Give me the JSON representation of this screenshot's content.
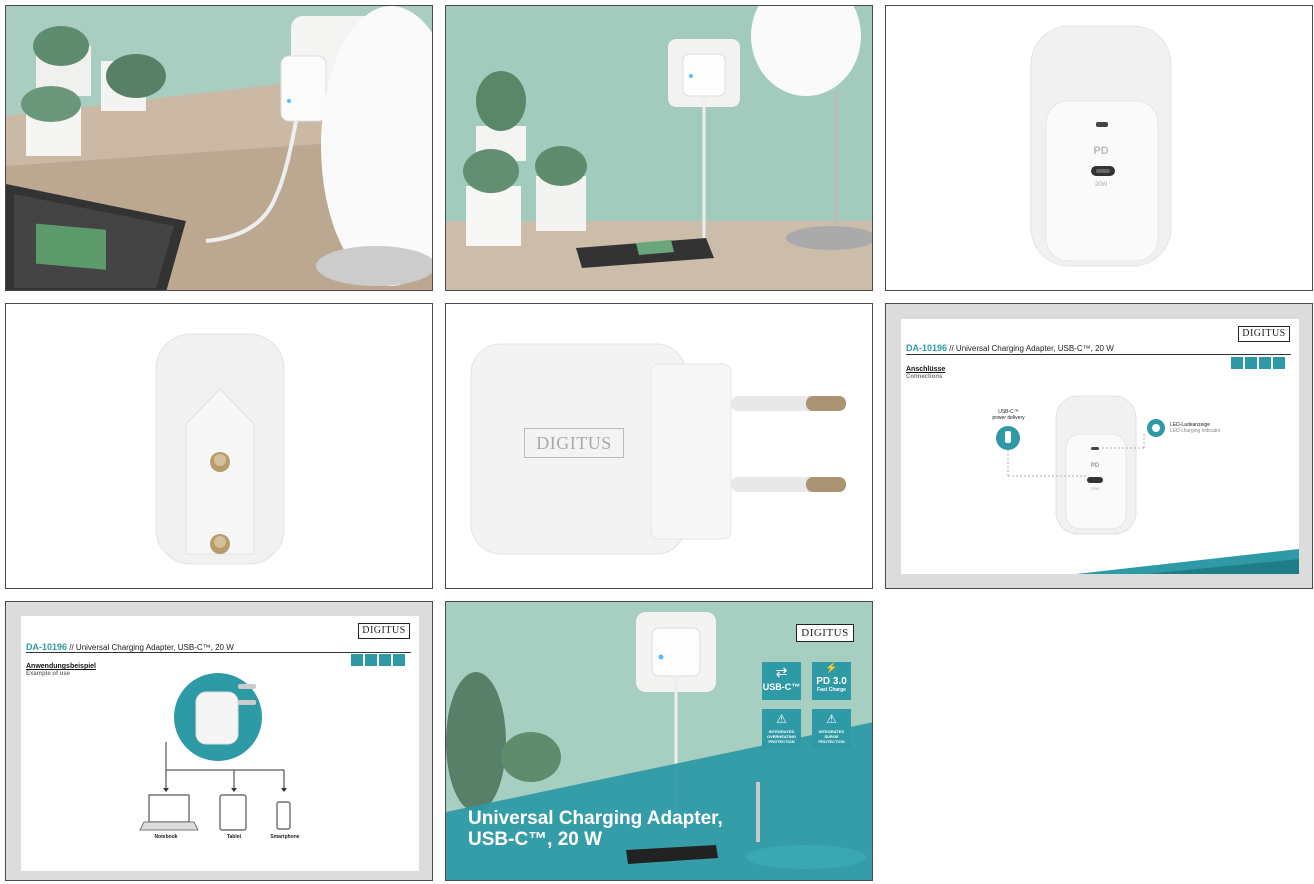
{
  "slide_panel_connections": {
    "sku": "DA-10196",
    "product": " //  Universal Charging Adapter, USB-C™, 20 W",
    "title": "Anschlüsse",
    "subtitle": "Connections",
    "usb_label_1": "USB-C™",
    "usb_label_2": "power delivery",
    "led_label_de": "LED-Ladeanzeige",
    "led_label_en": "LED charging indicator",
    "pd": "PD",
    "watt": "20W",
    "logo": "DIGITUS"
  },
  "slide_panel_use": {
    "sku": "DA-10196",
    "product": " //  Universal Charging Adapter, USB-C™, 20 W",
    "title": "Anwendungsbeispiel",
    "subtitle": "Example of use",
    "devices": [
      "Notebook",
      "Tablet",
      "Smartphone"
    ],
    "logo": "DIGITUS"
  },
  "product_photos": {
    "pd": "PD",
    "watt": "20W",
    "logo": "DIGITUS"
  },
  "banner": {
    "logo": "DIGITUS",
    "headline_line1": "Universal Charging Adapter,",
    "headline_line2": "USB-C™, 20 W",
    "badge1": "USB-C™",
    "badge2_big": "PD 3.0",
    "badge2_small": "Fast Charge",
    "badge3": "INTEGRATED OVERHEATING PROTECTION",
    "badge4": "INTEGRATED SURGE PROTECTION"
  },
  "colors": {
    "accent": "#2e9aa6",
    "wall": "#9ec9bb",
    "desk": "#cdbfae"
  }
}
